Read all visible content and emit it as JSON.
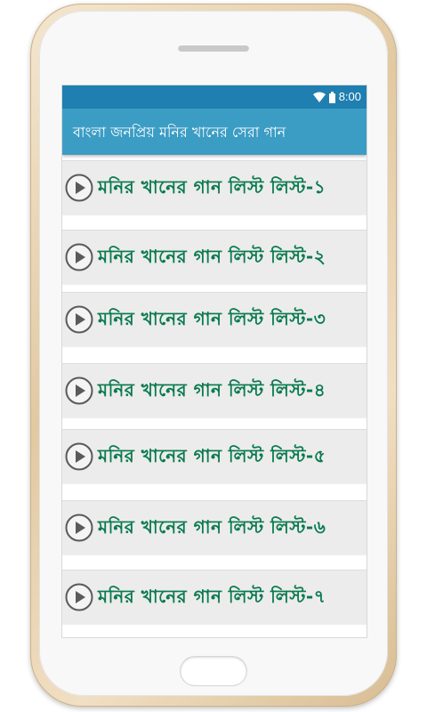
{
  "status_bar": {
    "time": "8:00"
  },
  "app_bar": {
    "title": "বাংলা জনপ্রিয় মনির খানের সেরা গান"
  },
  "list": {
    "items": [
      {
        "label": "মনির খানের গান লিস্ট লিস্ট-১"
      },
      {
        "label": "মনির খানের গান লিস্ট লিস্ট-২"
      },
      {
        "label": "মনির খানের গান লিস্ট লিস্ট-৩"
      },
      {
        "label": "মনির খানের গান লিস্ট লিস্ট-৪"
      },
      {
        "label": "মনির খানের গান লিস্ট লিস্ট-৫"
      },
      {
        "label": "মনির খানের গান লিস্ট লিস্ট-৬"
      },
      {
        "label": "মনির খানের গান লিস্ট লিস্ট-৭"
      }
    ]
  },
  "icons": {
    "item_icon": "play-button-icon",
    "status": [
      "wifi-icon",
      "battery-icon"
    ]
  },
  "colors": {
    "status_bar": "#1f7fb0",
    "app_bar": "#3c9dc4",
    "item_text": "#0a7a4f",
    "item_bg": "#ececec",
    "phone_frame": "#e8d4b2"
  }
}
